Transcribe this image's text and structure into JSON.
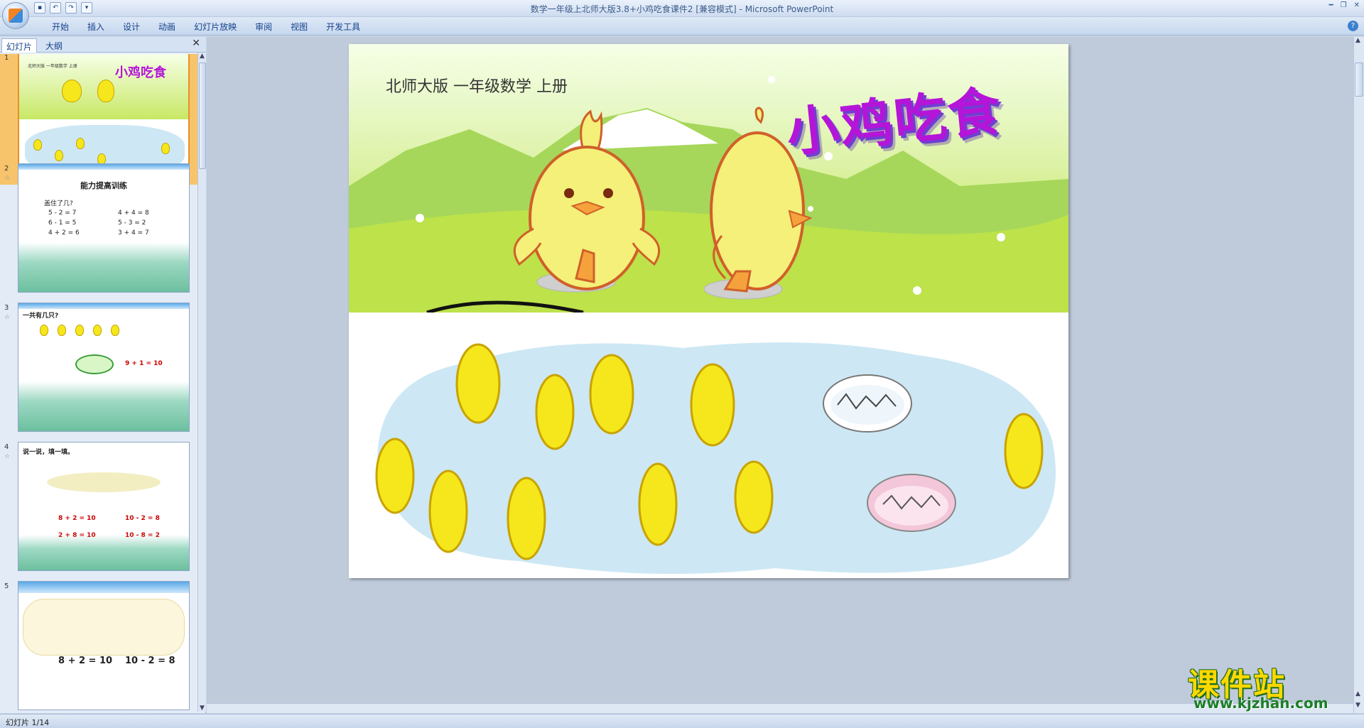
{
  "window": {
    "title": "数学一年级上北师大版3.8+小鸡吃食课件2 [兼容模式] - Microsoft PowerPoint"
  },
  "ribbon": {
    "tabs": [
      "开始",
      "插入",
      "设计",
      "动画",
      "幻灯片放映",
      "审阅",
      "视图",
      "开发工具"
    ]
  },
  "panel": {
    "tab_slides": "幻灯片",
    "tab_outline": "大纲",
    "close": "✕"
  },
  "thumbnails": [
    {
      "num": "1",
      "small_text": "北师大版 一年级数学 上册",
      "title": "小鸡吃食"
    },
    {
      "num": "2",
      "title": "能力提高训练",
      "line1": "盖住了几?",
      "eqs": [
        "5 - 2 = 7",
        "4 + 4 = 8",
        "6 - 1 = 5",
        "5 - 3 = 2",
        "4 + 2 = 6",
        "3 + 4 = 7"
      ]
    },
    {
      "num": "3",
      "title": "一共有几只?",
      "eq": "9 + 1 = 10"
    },
    {
      "num": "4",
      "title": "说一说，填一填。",
      "eqs": [
        "8 + 2 = 10",
        "10 - 2 = 8",
        "2 + 8 = 10",
        "10 - 8 = 2"
      ]
    },
    {
      "num": "5",
      "eqs": [
        "8 + 2 = 10",
        "10 - 2 = 8"
      ]
    }
  ],
  "slide": {
    "subtitle": "北师大版 一年级数学 上册",
    "title": "小鸡吃食"
  },
  "status": {
    "text": "幻灯片 1/14"
  },
  "watermark": {
    "line1": "课件站",
    "line2": "www.kjzhan.com"
  },
  "colors": {
    "title_purple": "#b415d8",
    "ribbon_blue": "#15428b",
    "thumb_selected": "#f7c46c"
  }
}
